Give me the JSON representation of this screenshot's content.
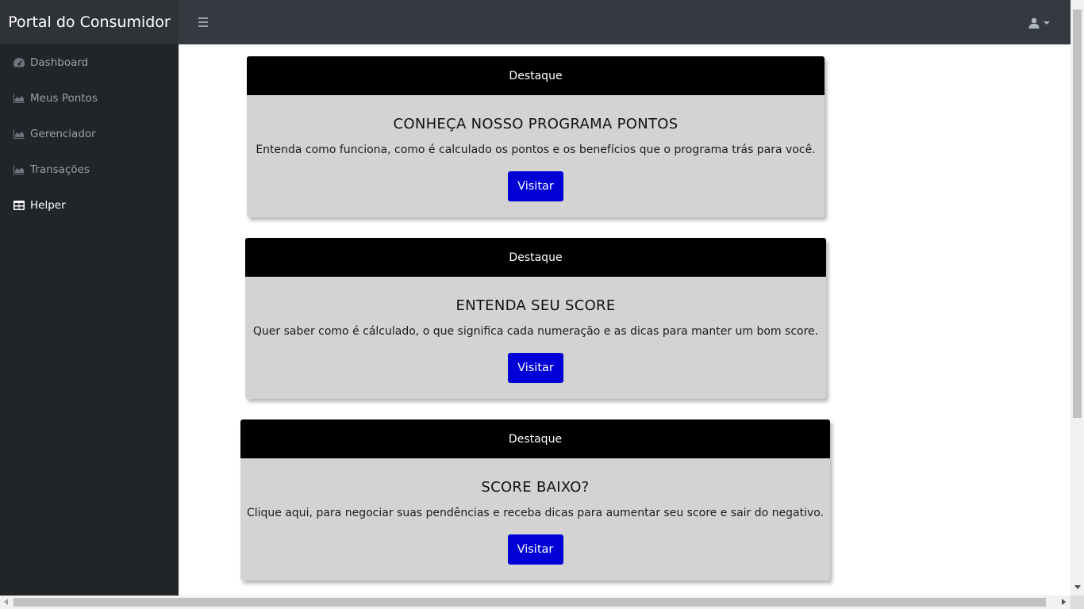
{
  "app": {
    "title": "Portal do Consumidor"
  },
  "topbar": {
    "menu_icon": "hamburger-icon",
    "user_icon": "user-icon"
  },
  "sidebar": {
    "items": [
      {
        "label": "Dashboard",
        "icon": "tachometer-icon",
        "active": false
      },
      {
        "label": "Meus Pontos",
        "icon": "area-chart-icon",
        "active": false
      },
      {
        "label": "Gerenciador",
        "icon": "area-chart-icon",
        "active": false
      },
      {
        "label": "Transações",
        "icon": "area-chart-icon",
        "active": false
      },
      {
        "label": "Helper",
        "icon": "table-icon",
        "active": true
      }
    ]
  },
  "cards": [
    {
      "header": "Destaque",
      "title": "CONHEÇA NOSSO PROGRAMA PONTOS",
      "text": "Entenda como funciona, como é calculado os pontos e os benefícios que o programa trás para você.",
      "button": "Visitar"
    },
    {
      "header": "Destaque",
      "title": "ENTENDA SEU SCORE",
      "text": "Quer saber como é cálculado, o que significa cada numeração e as dicas para manter um bom score.",
      "button": "Visitar"
    },
    {
      "header": "Destaque",
      "title": "SCORE BAIXO?",
      "text": "Clique aqui, para negociar suas pendências e receba dicas para aumentar seu score e sair do negativo.",
      "button": "Visitar"
    }
  ],
  "colors": {
    "topbar": "#343a40",
    "sidebar": "#212529",
    "card_header": "#000000",
    "card_body": "#d3d3d3",
    "button": "#0000d6"
  }
}
